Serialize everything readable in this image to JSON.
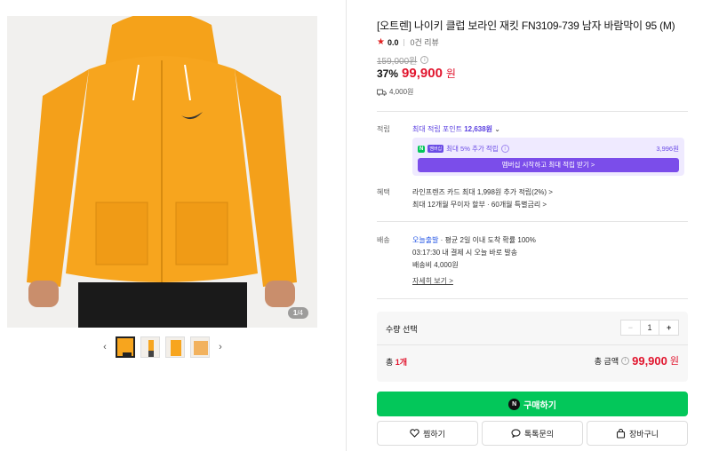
{
  "gallery": {
    "counter_current": "1",
    "counter_total": "/4",
    "thumb_prev_icon": "chevron-left-icon",
    "thumb_next_icon": "chevron-right-icon"
  },
  "product": {
    "title": "[오트렌] 나이키 클럽 보라인 재킷 FN3109-739 남자 바람막이 95 (M)",
    "rating_score": "0.0",
    "review_count": "0건 리뷰",
    "original_price": "159,000원",
    "discount_rate": "37%",
    "sale_price": "99,900",
    "sale_unit": "원",
    "shipping_fee_line": "4,000원"
  },
  "points": {
    "label": "적립",
    "max_prefix": "최대 적립 포인트",
    "max_value": "12,638원",
    "member_badge_n": "N",
    "member_badge_tag": "멤버십",
    "member_text": "최대 5% 추가 적립",
    "member_value": "3,996원",
    "member_button": "멤버십 시작하고 최대 적립 받기 >"
  },
  "benefits": {
    "label": "혜택",
    "line1": "라인프렌즈 카드 최대 1,998원 추가 적립(2%) >",
    "line2": "최대 12개월 무이자 할부 · 60개월 특별금리 >"
  },
  "delivery": {
    "label": "배송",
    "today_tag": "오늘출발",
    "line1_rest": " · 평균 2일 이내 도착 확률 100%",
    "line2": "03:17:30  내 결제 시 오늘 바로 발송",
    "line3": "배송비 4,000원",
    "detail_link": "자세히 보기 >"
  },
  "quantity": {
    "label": "수량 선택",
    "minus": "−",
    "value": "1",
    "plus": "+",
    "total_count_prefix": "총 ",
    "total_count": "1개",
    "total_price_label": "총 금액",
    "total_price": "99,900",
    "total_unit": "원"
  },
  "actions": {
    "buy_badge": "N",
    "buy_label": "구매하기",
    "wish_label": "찜하기",
    "talk_label": "톡톡문의",
    "cart_label": "장바구니"
  },
  "colors": {
    "price_red": "#e1142d",
    "naver_green": "#03c75a",
    "member_purple": "#7b4dea",
    "jacket_yellow": "#f7a51e"
  }
}
